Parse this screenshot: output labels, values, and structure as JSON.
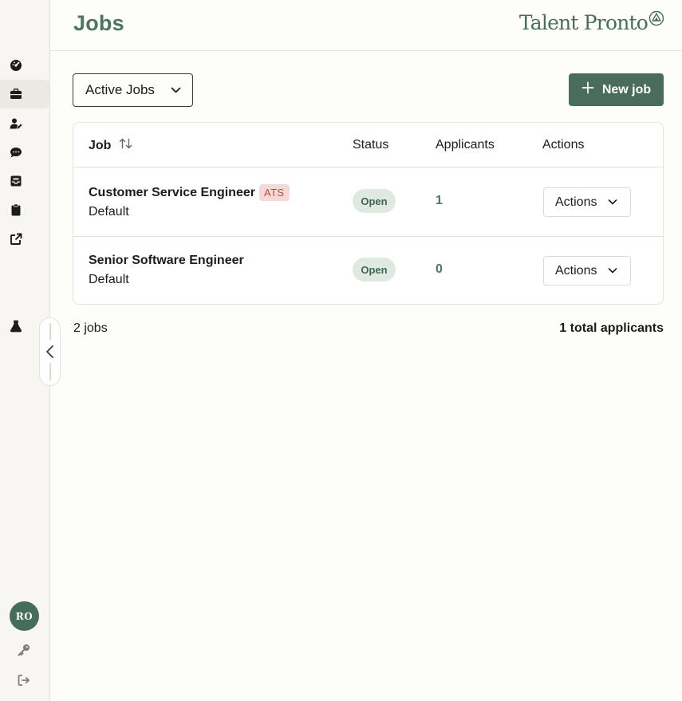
{
  "header": {
    "title": "Jobs",
    "logo_text": "Talent Pronto"
  },
  "sidebar": {
    "items": [
      {
        "icon": "dashboard-gauge-icon"
      },
      {
        "icon": "briefcase-icon",
        "active": true
      },
      {
        "icon": "user-edit-icon"
      },
      {
        "icon": "chat-bubble-icon"
      },
      {
        "icon": "inbox-icon"
      },
      {
        "icon": "clipboard-icon"
      },
      {
        "icon": "external-link-icon"
      },
      {
        "icon": "flask-icon"
      }
    ],
    "avatar_initials": "RO",
    "bottom": [
      {
        "icon": "key-icon"
      },
      {
        "icon": "logout-icon"
      }
    ]
  },
  "toolbar": {
    "filter_value": "Active Jobs",
    "new_job_label": "New job"
  },
  "table": {
    "headers": {
      "job": "Job",
      "status": "Status",
      "applicants": "Applicants",
      "actions": "Actions"
    },
    "rows": [
      {
        "title": "Customer Service Engineer",
        "badge": "ATS",
        "subtitle": "Default",
        "status": "Open",
        "applicants": "1",
        "actions_label": "Actions"
      },
      {
        "title": "Senior Software Engineer",
        "subtitle": "Default",
        "status": "Open",
        "applicants": "0",
        "actions_label": "Actions"
      }
    ]
  },
  "summary": {
    "job_count": "2 jobs",
    "total_applicants": "1 total applicants"
  },
  "colors": {
    "brand": "#4a6c5d",
    "status_open_bg": "#dfe9e2",
    "ats_badge_bg": "#f6d9d6",
    "ats_badge_text": "#b44d45"
  }
}
